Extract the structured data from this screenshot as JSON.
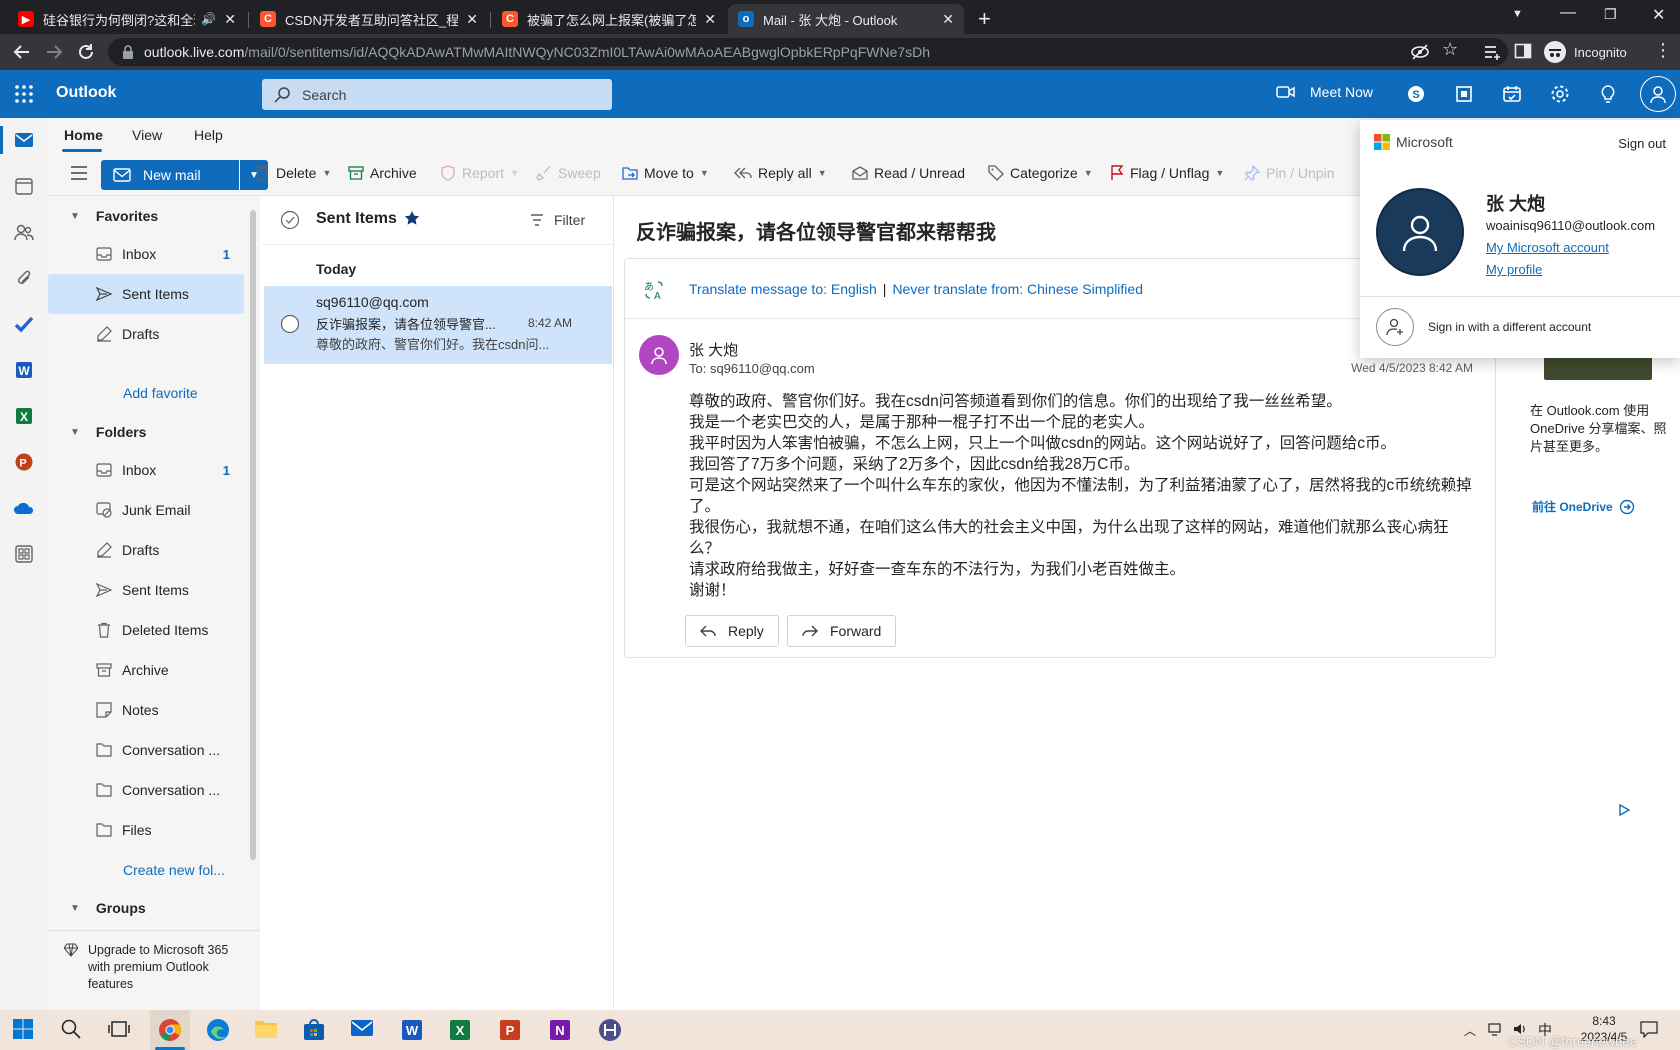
{
  "browser": {
    "tabs": [
      {
        "title": "硅谷银行为何倒闭?这和全球",
        "favicon_color": "#ff0000"
      },
      {
        "title": "CSDN开发者互助问答社区_程序",
        "favicon_color": "#fc5531",
        "favicon_letter": "C"
      },
      {
        "title": "被骗了怎么网上报案(被骗了怎么",
        "favicon_color": "#fc5531",
        "favicon_letter": "C"
      },
      {
        "title": "Mail - 张 大炮 - Outlook",
        "favicon_color": "#0f6cbd"
      }
    ],
    "url_host": "outlook.live.com",
    "url_path": "/mail/0/sentitems/id/AQQkADAwATMwMAItNWQyNC03ZmI0LTAwAi0wMAoAEABgwglOpbkERpPqFWNe7sDh",
    "incognito_label": "Incognito"
  },
  "header": {
    "app_name": "Outlook",
    "search_placeholder": "Search",
    "meet_now": "Meet Now"
  },
  "ribbon": {
    "tabs": [
      "Home",
      "View",
      "Help"
    ],
    "new_mail": "New mail",
    "delete": "Delete",
    "archive": "Archive",
    "report": "Report",
    "sweep": "Sweep",
    "move_to": "Move to",
    "reply_all": "Reply all",
    "read_unread": "Read / Unread",
    "categorize": "Categorize",
    "flag": "Flag / Unflag",
    "pin": "Pin / Unpin"
  },
  "folders": {
    "favorites_label": "Favorites",
    "favorites": [
      {
        "name": "Inbox",
        "count": "1"
      },
      {
        "name": "Sent Items",
        "count": ""
      },
      {
        "name": "Drafts",
        "count": ""
      }
    ],
    "add_favorite": "Add favorite",
    "folders_label": "Folders",
    "items": [
      {
        "name": "Inbox",
        "count": "1"
      },
      {
        "name": "Junk Email",
        "count": ""
      },
      {
        "name": "Drafts",
        "count": ""
      },
      {
        "name": "Sent Items",
        "count": ""
      },
      {
        "name": "Deleted Items",
        "count": ""
      },
      {
        "name": "Archive",
        "count": ""
      },
      {
        "name": "Notes",
        "count": ""
      },
      {
        "name": "Conversation ...",
        "count": ""
      },
      {
        "name": "Conversation ...",
        "count": ""
      },
      {
        "name": "Files",
        "count": ""
      }
    ],
    "create_new": "Create new fol...",
    "groups_label": "Groups",
    "upgrade_text": "Upgrade to Microsoft 365 with premium Outlook features"
  },
  "message_list": {
    "title": "Sent Items",
    "filter": "Filter",
    "group": "Today",
    "item": {
      "to": "sq96110@qq.com",
      "subject": "反诈骗报案，请各位领导警官...",
      "time": "8:42 AM",
      "preview": "尊敬的政府、警官你们好。我在csdn问..."
    }
  },
  "reading": {
    "subject": "反诈骗报案，请各位领导警官都来帮帮我",
    "translate_text": "Translate message to: English",
    "never_translate": "Never translate from: Chinese Simplified",
    "sender": "张 大炮",
    "to": "To:  sq96110@qq.com",
    "date": "Wed 4/5/2023 8:42 AM",
    "body": [
      "尊敬的政府、警官你们好。我在csdn问答频道看到你们的信息。你们的出现给了我一丝丝希望。",
      "我是一个老实巴交的人，是属于那种一棍子打不出一个屁的老实人。",
      "我平时因为人笨害怕被骗，不怎么上网，只上一个叫做csdn的网站。这个网站说好了，回答问题给c币。",
      "我回答了7万多个问题，采纳了2万多个，因此csdn给我28万C币。",
      "可是这个网站突然来了一个叫什么车东的家伙，他因为不懂法制，为了利益猪油蒙了心了，居然将我的c币统统赖掉了。",
      "我很伤心，我就想不通，在咱们这么伟大的社会主义中国，为什么出现了这样的网站，难道他们就那么丧心病狂么？",
      "请求政府给我做主，好好查一查车东的不法行为，为我们小老百姓做主。",
      "谢谢！"
    ],
    "reply": "Reply",
    "forward": "Forward"
  },
  "ad": {
    "text": "在 Outlook.com 使用 OneDrive 分享檔案、照片甚至更多。",
    "link": "前往 OneDrive"
  },
  "account": {
    "brand": "Microsoft",
    "sign_out": "Sign out",
    "name": "张 大炮",
    "email": "woainisq96110@outlook.com",
    "my_account": "My Microsoft account",
    "my_profile": "My profile",
    "other_account": "Sign in with a different account"
  },
  "taskbar": {
    "time": "8:43",
    "date": "2023/4/5",
    "ime": "中",
    "watermark": "CSDN @threenewbee"
  },
  "colors": {
    "outlook_blue": "#0f6cbd",
    "selection": "#cfe4fa",
    "avatar_purple": "#b146c2"
  }
}
